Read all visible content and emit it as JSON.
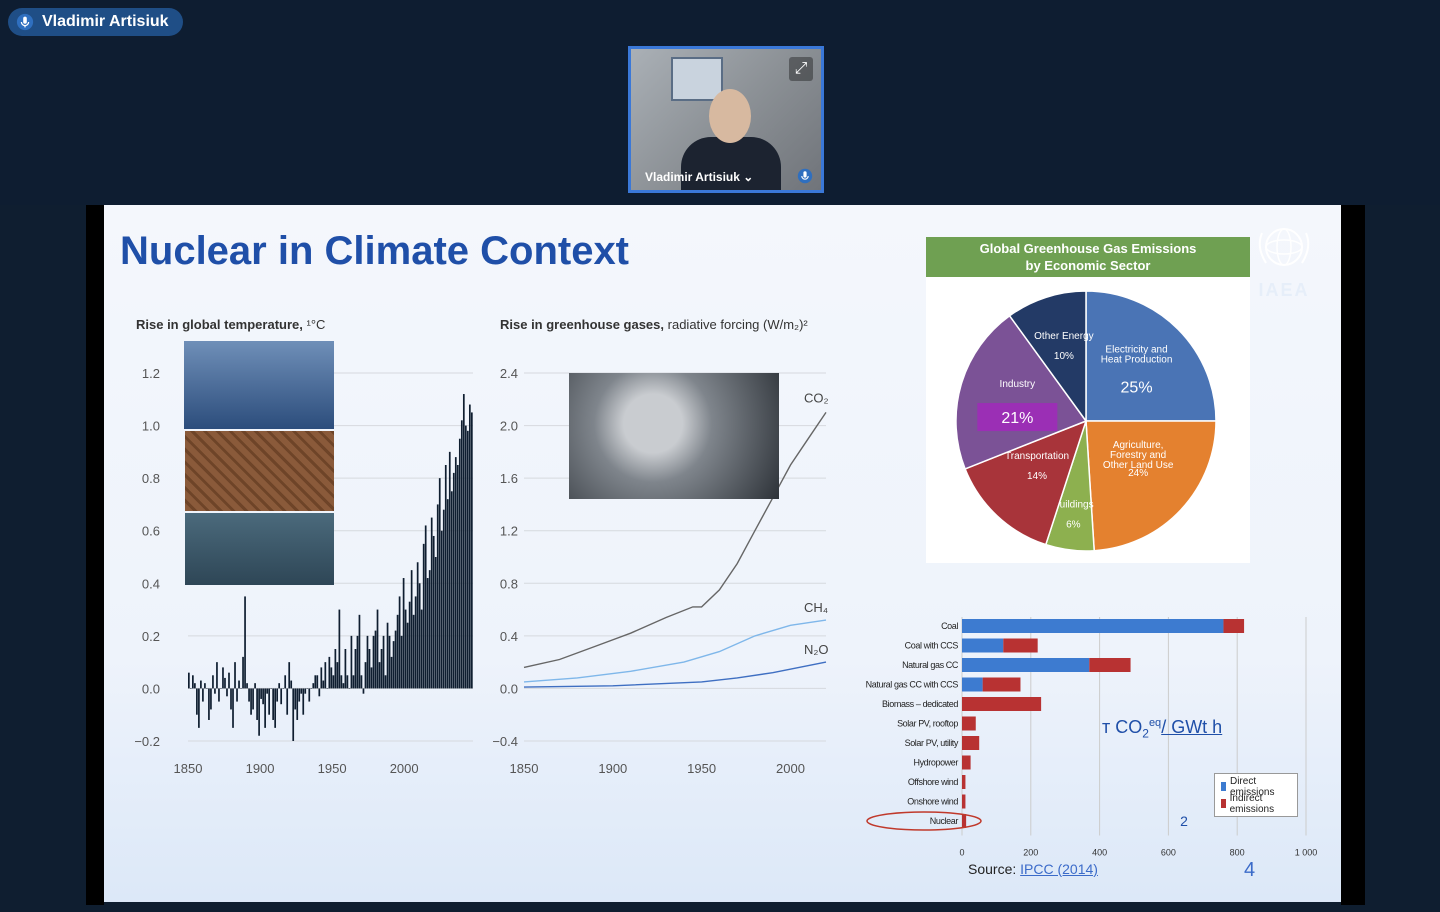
{
  "meeting": {
    "active_speaker": "Vladimir Artisiuk",
    "video_tile_name": "Vladimir Artisiuk ⌄"
  },
  "slide": {
    "title": "Nuclear in Climate Context",
    "logo_text": "IAEA",
    "slide_number": "4",
    "source_label": "Source:",
    "source_link": "IPCC (2014)",
    "unit_label_pre": "т CO",
    "unit_label_post": "/ GWt h",
    "unit_sub": "2",
    "unit_sup": "eq"
  },
  "temp_chart_title": "Rise in global temperature,",
  "temp_chart_unit": "¹°C",
  "ghg_chart_title": "Rise in greenhouse gases,",
  "ghg_chart_unit": "radiative forcing (W/m₂)²",
  "pie_title_line1": "Global Greenhouse Gas Emissions",
  "pie_title_line2": "by Economic Sector",
  "bar_legend": [
    "Direct emissions",
    "Indirect emissions"
  ],
  "nuclear_value_label": "2",
  "colors": {
    "title_blue": "#1f4fa8",
    "direct": "#3d7bd0",
    "indirect": "#b83232",
    "temp_bars": "#0f1e30"
  },
  "chart_data": [
    {
      "type": "bar",
      "title": "Rise in global temperature,",
      "x_ticks": [
        "1850",
        "1900",
        "1950",
        "2000"
      ],
      "y_ticks": [
        "1.2",
        "1.0",
        "0.8",
        "0.6",
        "0.4",
        "0.2",
        "0.0",
        "−0.2"
      ],
      "ylim": [
        -0.2,
        1.2
      ],
      "xlim": [
        1850,
        2020
      ],
      "note": "",
      "values": [
        0.06,
        0.0,
        0.05,
        0.02,
        -0.1,
        -0.15,
        0.03,
        -0.05,
        0.02,
        0.0,
        -0.12,
        -0.08,
        0.05,
        -0.02,
        0.1,
        -0.05,
        0.0,
        0.08,
        0.04,
        -0.03,
        0.06,
        -0.08,
        -0.15,
        0.1,
        -0.05,
        0.03,
        0.0,
        0.12,
        0.35,
        0.02,
        -0.05,
        -0.1,
        -0.08,
        0.02,
        -0.12,
        -0.18,
        -0.04,
        -0.06,
        -0.15,
        -0.02,
        -0.1,
        0.0,
        -0.12,
        -0.15,
        -0.05,
        0.02,
        -0.06,
        0.0,
        0.05,
        -0.1,
        0.1,
        0.03,
        -0.2,
        -0.08,
        -0.12,
        -0.05,
        -0.02,
        -0.1,
        -0.02,
        0.0,
        -0.05,
        0.0,
        0.02,
        0.05,
        0.05,
        -0.03,
        0.08,
        0.03,
        0.1,
        0.0,
        0.12,
        0.08,
        0.05,
        0.15,
        0.1,
        0.3,
        0.05,
        0.02,
        0.15,
        0.05,
        0.0,
        0.2,
        0.05,
        0.15,
        0.2,
        0.28,
        0.05,
        -0.02,
        0.1,
        0.2,
        0.15,
        0.08,
        0.2,
        0.22,
        0.3,
        0.1,
        0.15,
        0.2,
        0.05,
        0.25,
        0.2,
        0.12,
        0.18,
        0.22,
        0.28,
        0.35,
        0.2,
        0.42,
        0.3,
        0.25,
        0.33,
        0.45,
        0.28,
        0.35,
        0.48,
        0.4,
        0.3,
        0.55,
        0.62,
        0.42,
        0.45,
        0.65,
        0.58,
        0.5,
        0.7,
        0.8,
        0.6,
        0.68,
        0.85,
        0.72,
        0.9,
        0.75,
        0.82,
        0.88,
        0.85,
        0.95,
        1.02,
        1.12,
        1.0,
        0.98,
        1.08,
        1.05
      ]
    },
    {
      "type": "line",
      "title": "Rise in greenhouse gases,",
      "x_ticks": [
        "1850",
        "1900",
        "1950",
        "2000"
      ],
      "y_ticks": [
        "2.4",
        "2.0",
        "1.6",
        "1.2",
        "0.8",
        "0.4",
        "0.0",
        "−0.4"
      ],
      "ylim": [
        -0.4,
        2.4
      ],
      "xlim": [
        1850,
        2020
      ],
      "series": [
        {
          "name": "CO",
          "x": [
            1850,
            1870,
            1890,
            1910,
            1930,
            1945,
            1950,
            1960,
            1970,
            1980,
            1990,
            2000,
            2010,
            2020
          ],
          "y": [
            0.16,
            0.22,
            0.32,
            0.42,
            0.54,
            0.62,
            0.62,
            0.75,
            0.95,
            1.2,
            1.45,
            1.7,
            1.9,
            2.1
          ]
        },
        {
          "name": "CH",
          "x": [
            1850,
            1880,
            1910,
            1940,
            1960,
            1980,
            2000,
            2020
          ],
          "y": [
            0.05,
            0.08,
            0.13,
            0.2,
            0.28,
            0.4,
            0.48,
            0.52
          ]
        },
        {
          "name": "N O",
          "x": [
            1850,
            1900,
            1950,
            1970,
            1990,
            2020
          ],
          "y": [
            0.01,
            0.02,
            0.05,
            0.08,
            0.12,
            0.2
          ]
        }
      ],
      "series_labels": [
        "CO₂",
        "CH₄",
        "N₂O"
      ]
    },
    {
      "type": "pie",
      "title": "Global Greenhouse Gas Emissions by Economic Sector",
      "slices": [
        {
          "label": "Electricity and Heat Production",
          "value_label": "25%",
          "value": 25,
          "color": "#4a74b5"
        },
        {
          "label": "Agriculture, Forestry and Other Land Use",
          "value_label": "24%",
          "value": 24,
          "color": "#e4812f"
        },
        {
          "label": "Buildings",
          "value_label": "6%",
          "value": 6,
          "color": "#8db04f"
        },
        {
          "label": "Transportation",
          "value_label": "14%",
          "value": 14,
          "color": "#a8343a"
        },
        {
          "label": "Industry",
          "value_label": "21%",
          "value": 21,
          "color": "#7b5296"
        },
        {
          "label": "Other Energy",
          "value_label": "10%",
          "value": 10,
          "color": "#233a66"
        }
      ]
    },
    {
      "type": "bar",
      "orientation": "horizontal",
      "title": "",
      "categories": [
        "Coal",
        "Coal with CCS",
        "Natural gas CC",
        "Natural gas CC with CCS",
        "Biomass – dedicated",
        "Solar PV, rooftop",
        "Solar PV, utility",
        "Hydropower",
        "Offshore wind",
        "Onshore wind",
        "Nuclear"
      ],
      "x_ticks": [
        "0",
        "200",
        "400",
        "600",
        "800",
        "1 000"
      ],
      "xlim": [
        0,
        1000
      ],
      "series": [
        {
          "name": "Direct emissions",
          "values": [
            760,
            120,
            370,
            60,
            0,
            0,
            0,
            0,
            0,
            0,
            0
          ]
        },
        {
          "name": "Indirect emissions",
          "values": [
            60,
            100,
            120,
            110,
            230,
            40,
            50,
            25,
            10,
            10,
            12
          ]
        }
      ]
    }
  ]
}
